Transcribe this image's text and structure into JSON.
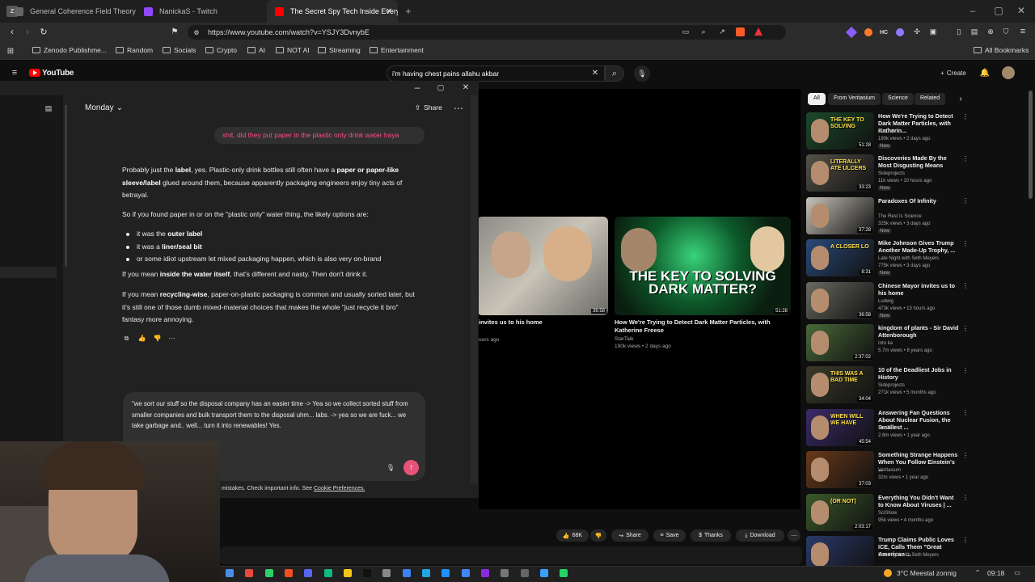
{
  "tabs": [
    {
      "title": "General Coherence Field Theory (GCI",
      "color": "#5a5a5a"
    },
    {
      "title": "NanickaS - Twitch",
      "color": "#9147ff"
    },
    {
      "title": "The Secret Spy Tech Inside Every",
      "color": "#ff0000"
    }
  ],
  "browser": {
    "url": "https://www.youtube.com/watch?v=YSJY3Dvnyb E",
    "url_display": "https://www.youtube.com/watch?v=YSJY3DvnybE"
  },
  "bookmarks": [
    "Zenodo Publishme...",
    "Random",
    "Socials",
    "Crypto",
    "AI",
    "NOT AI",
    "Streaming",
    "Entertainment"
  ],
  "all_bookmarks": "All Bookmarks",
  "youtube": {
    "logo": "YouTube",
    "search_value": "i'm having chest pains allahu akbar",
    "create": "Create"
  },
  "chat": {
    "title": "Monday",
    "share": "Share",
    "user_message": "shit, did they put paper in the plastic only drink water haya",
    "p1_a": "Probably just the ",
    "p1_b": "label",
    ", yes. Plastic-only drink bottles still often have a ": "",
    "p1": [
      "Probably just the ",
      "label",
      ", yes. Plastic-only drink bottles still often have a ",
      "paper or paper-like sleeve/label",
      " glued around them, because apparently packaging engineers enjoy tiny acts of betrayal."
    ],
    "p2": "So if you found paper in or on the \"plastic only\" water thing, the likely options are:",
    "bullets": [
      [
        "it was the ",
        "outer label"
      ],
      [
        "it was a ",
        "liner/seal bit"
      ],
      [
        "or some idiot upstream let mixed packaging happen, which is also very on-brand",
        ""
      ]
    ],
    "p3": [
      "If you mean ",
      "inside the water itself",
      ", that's different and nasty. Then don't drink it."
    ],
    "p4": [
      "If you mean ",
      "recycling-wise",
      ", paper-on-plastic packaging is common and usually sorted later, but it's still one of those dumb mixed-material choices that makes the whole \"just recycle it bro\" fantasy more annoying."
    ],
    "draft": "\"we sort our stuff so the disposal company has an easier time -> Yea so we collect sorted stuff from smaller companies and bulk transport them to the disposal uhm... labs. -> yea so we are fuck... we take garbage and.. well... turn it into renewables! Yes.",
    "disclaimer": "mistakes. Check important info. See ",
    "cookie": "Cookie Preferences."
  },
  "feed": [
    {
      "title": "invites us to his home",
      "dur": "36:58",
      "meta": "ours ago"
    },
    {
      "title": "How We're Trying to Detect Dark Matter Particles, with Katherine Freese",
      "channel": "StarTalk",
      "meta": "190k views • 2 days ago",
      "dur": "51:28",
      "thumb_text": "THE KEY TO SOLVING DARK MATTER?"
    }
  ],
  "chips": [
    "All",
    "From Veritasium",
    "Science",
    "Related"
  ],
  "related": [
    {
      "title": "How We're Trying to Detect Dark Matter Particles, with Katherin...",
      "channel": "StarTalk",
      "meta": "190k views • 2 days ago",
      "badge": "New",
      "dur": "51:28",
      "color": "#1b4a2a",
      "text": "THE KEY TO SOLVING"
    },
    {
      "title": "Discoveries Made By the Most Disgusting Means",
      "channel": "Sideprojects",
      "meta": "11k views • 10 hours ago",
      "badge": "New",
      "dur": "33:23",
      "color": "#55524b",
      "text": "LITERALLY ATE ULCERS"
    },
    {
      "title": "Paradoxes Of Infinity",
      "channel": "The Rest Is Science",
      "meta": "325k views • 3 days ago",
      "badge": "New",
      "dur": "37:28",
      "color": "#c9c3ba",
      "text": ""
    },
    {
      "title": "Mike Johnson Gives Trump Another Made-Up Trophy, ...",
      "channel": "Late Night with Seth Meyers",
      "meta": "775k views • 3 days ago",
      "badge": "New",
      "dur": "8:31",
      "color": "#2a4a7a",
      "text": "A CLOSER LO"
    },
    {
      "title": "Chinese Mayor invites us to his home",
      "channel": "Ludwig",
      "meta": "473k views • 13 hours ago",
      "badge": "New",
      "dur": "36:58",
      "color": "#6a6a62",
      "text": ""
    },
    {
      "title": "kingdom of plants - Sir David Attenborough",
      "channel": "Into ka",
      "meta": "5.7m views • 8 years ago",
      "badge": "",
      "dur": "2:37:02",
      "color": "#4a6a3a",
      "text": ""
    },
    {
      "title": "10 of the Deadliest Jobs in History",
      "channel": "Sideprojects",
      "meta": "271k views • 5 months ago",
      "badge": "",
      "dur": "34:04",
      "color": "#3b3b2b",
      "text": "THIS WAS A BAD TIME"
    },
    {
      "title": "Answering Fan Questions About Nuclear Fusion, the Smallest ...",
      "channel": "StarTalk",
      "meta": "2.6m views • 1 year ago",
      "badge": "",
      "dur": "45:54",
      "color": "#3a2a6a",
      "text": "WHEN WILL WE HAVE"
    },
    {
      "title": "Something Strange Happens When You Follow Einstein's ...",
      "channel": "Veritasium",
      "meta": "32m views • 1 year ago",
      "badge": "",
      "dur": "37:03",
      "color": "#6a3a1a",
      "text": ""
    },
    {
      "title": "Everything You Didn't Want to Know About Viruses | ...",
      "channel": "SciShow",
      "meta": "95k views • 4 months ago",
      "badge": "",
      "dur": "2:03:17",
      "color": "#3a5a2a",
      "text": "(OR NOT)"
    },
    {
      "title": "Trump Claims Public Loves ICE, Calls Them \"Great American ...",
      "channel": "Late Night with Seth Meyers",
      "meta": "",
      "badge": "",
      "dur": "",
      "color": "#2a3a6a",
      "text": ""
    }
  ],
  "actions": {
    "likes": "68K",
    "share": "Share",
    "save": "Save",
    "thanks": "Thanks",
    "download": "Download"
  },
  "taskbar": {
    "weather": "3°C  Meestal zonnig",
    "time": "09:18"
  },
  "colors": {
    "accent_pink": "#ff4b88",
    "yt_red": "#ff0000",
    "send": "#e8537a"
  }
}
